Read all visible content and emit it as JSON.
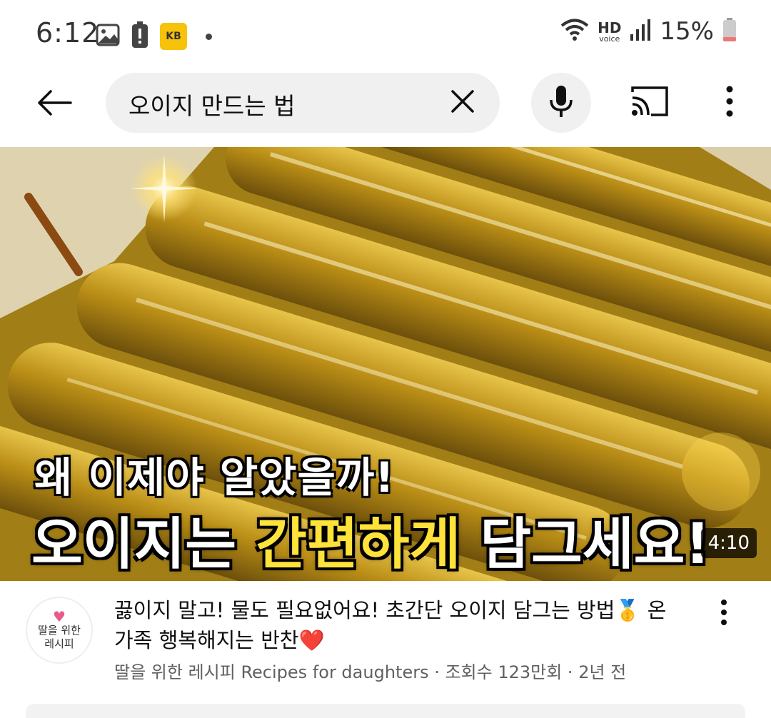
{
  "status_bar": {
    "time": "6:12",
    "kb_badge": "KB",
    "hd": "HD",
    "voice": "voice",
    "battery": "15%"
  },
  "search": {
    "query": "오이지 만드는 법"
  },
  "video": {
    "overlay_line1": "왜 이제야 알았을까!",
    "overlay_line2_start": "오이지는 ",
    "overlay_line2_highlight": "간편하게",
    "overlay_line2_end": " 담그세요!",
    "duration": "4:10",
    "title": "끓이지 말고! 물도 필요없어요! 초간단 오이지 담그는 방법🥇 온가족 행복해지는 반찬❤️",
    "meta": "딸을 위한 레시피 Recipes for daughters · 조회수 123만회 · 2년 전",
    "channel_avatar_line1": "딸을 위한",
    "channel_avatar_line2": "레시피"
  },
  "icons": {
    "status": [
      "gallery-icon",
      "battery-alert-icon",
      "kb-app-icon",
      "wifi-icon",
      "signal-icon",
      "battery-icon"
    ],
    "header": [
      "back-arrow-icon",
      "close-icon",
      "mic-icon",
      "cast-icon",
      "more-vert-icon"
    ]
  },
  "colors": {
    "highlight_text": "#ffe23a",
    "search_bg": "#f0f0f0",
    "meta_text": "#606060",
    "avatar_heart": "#e65c8a"
  }
}
